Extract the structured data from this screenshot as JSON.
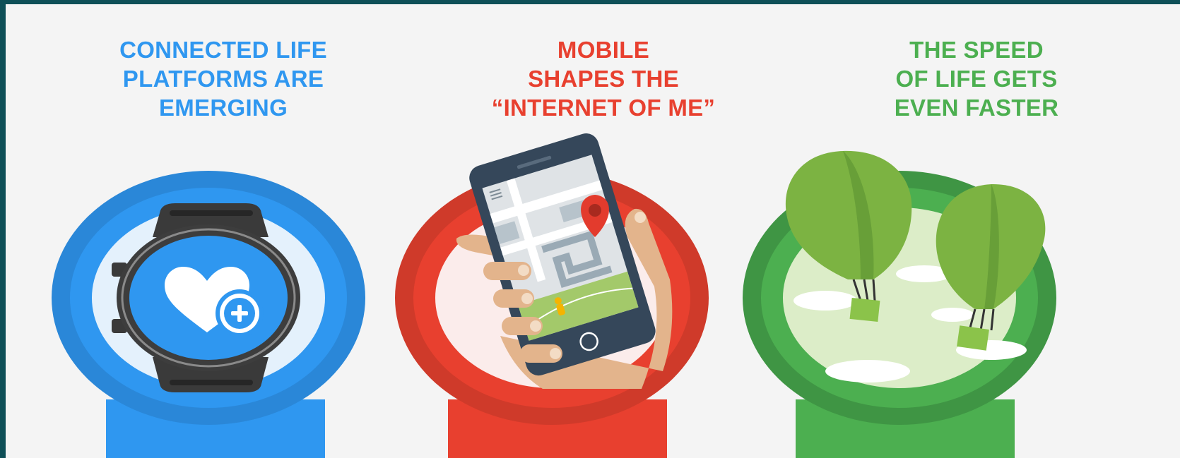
{
  "panels": [
    {
      "title_lines": [
        "CONNECTED LIFE",
        "PLATFORMS ARE",
        "EMERGING"
      ],
      "color": "#2f97f0",
      "illustration": "smartwatch-health-icon"
    },
    {
      "title_lines": [
        "MOBILE",
        "SHAPES THE",
        "“INTERNET OF ME”"
      ],
      "color": "#e8402f",
      "illustration": "phone-map-hand"
    },
    {
      "title_lines": [
        "THE SPEED",
        "OF LIFE GETS",
        "EVEN FASTER"
      ],
      "color": "#4caf50",
      "illustration": "hot-air-balloons"
    }
  ],
  "colors": {
    "outer_border": "#0e4f57",
    "background": "#f4f4f4",
    "blue": "#2f97f0",
    "red": "#e8402f",
    "green": "#4caf50"
  }
}
